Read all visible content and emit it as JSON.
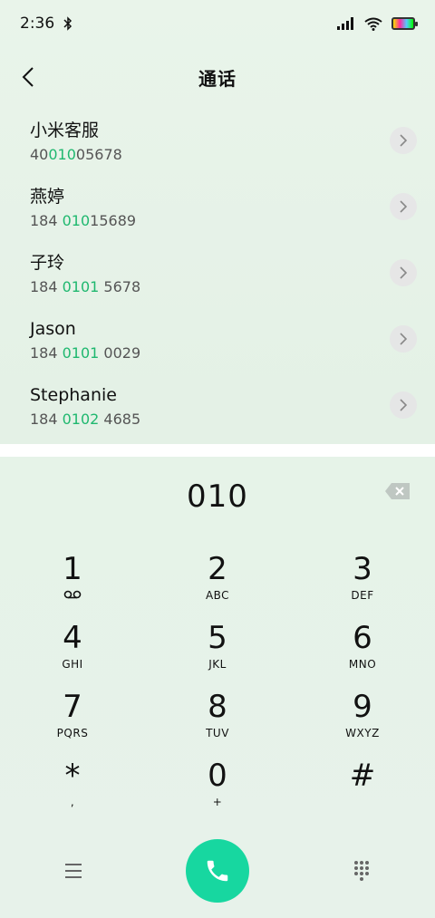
{
  "status": {
    "time": "2:36"
  },
  "header": {
    "title": "通话"
  },
  "contacts": [
    {
      "name": "小米客服",
      "number_pre": "40",
      "number_match": "010",
      "number_post": "05678"
    },
    {
      "name": "燕婷",
      "number_pre": "184 ",
      "number_match": "010",
      "number_post": "15689"
    },
    {
      "name": "子玲",
      "number_pre": "184 ",
      "number_match": "0101",
      "number_post": " 5678"
    },
    {
      "name": "Jason",
      "number_pre": "184 ",
      "number_match": "0101",
      "number_post": " 0029"
    },
    {
      "name": "Stephanie",
      "number_pre": "184 ",
      "number_match": "0102",
      "number_post": " 4685"
    }
  ],
  "dialer": {
    "input": "010",
    "keys": [
      {
        "digit": "1",
        "letters": ""
      },
      {
        "digit": "2",
        "letters": "ABC"
      },
      {
        "digit": "3",
        "letters": "DEF"
      },
      {
        "digit": "4",
        "letters": "GHI"
      },
      {
        "digit": "5",
        "letters": "JKL"
      },
      {
        "digit": "6",
        "letters": "MNO"
      },
      {
        "digit": "7",
        "letters": "PQRS"
      },
      {
        "digit": "8",
        "letters": "TUV"
      },
      {
        "digit": "9",
        "letters": "WXYZ"
      },
      {
        "digit": "*",
        "letters": ","
      },
      {
        "digit": "0",
        "letters": "+"
      },
      {
        "digit": "#",
        "letters": ""
      }
    ]
  },
  "colors": {
    "accent": "#17d7a0",
    "match": "#1fb86f"
  },
  "icons": {
    "voicemail": "voicemail-icon",
    "back": "back-icon",
    "chevron": "chevron-right-icon",
    "backspace": "backspace-icon",
    "menu": "menu-icon",
    "call": "phone-icon",
    "dialpad": "dialpad-icon"
  }
}
